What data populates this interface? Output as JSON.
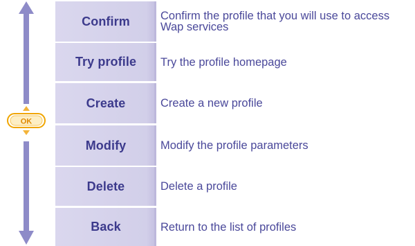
{
  "nav": {
    "ok_label": "OK",
    "colors": {
      "arrow": "#8e8bc8",
      "ok_border": "#f0a500",
      "ok_fill": "#fdeec4",
      "ok_text": "#e08800",
      "small_arrows": "#f3b43a"
    }
  },
  "menu": {
    "colors": {
      "key_background": "#d6d3ec",
      "key_text": "#3c3a8c",
      "desc_text": "#4a489a"
    },
    "items": [
      {
        "label": "Confirm",
        "description": "Confirm the profile that you will use to access Wap services"
      },
      {
        "label": "Try profile",
        "description": "Try the profile homepage"
      },
      {
        "label": "Create",
        "description": "Create a new profile"
      },
      {
        "label": "Modify",
        "description": "Modify the profile parameters"
      },
      {
        "label": "Delete",
        "description": "Delete a profile"
      },
      {
        "label": "Back",
        "description": "Return to the list of profiles"
      }
    ]
  }
}
